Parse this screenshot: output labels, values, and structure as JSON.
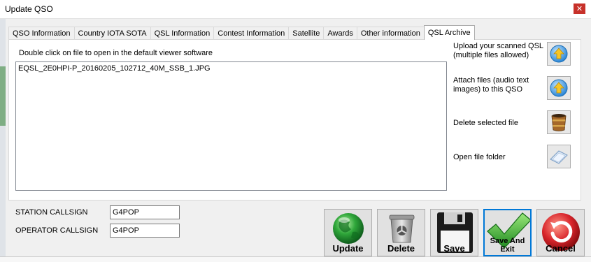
{
  "window": {
    "title": "Update QSO",
    "close_glyph": "✕"
  },
  "tabs": [
    {
      "label": "QSO Information",
      "active": false
    },
    {
      "label": "Country IOTA SOTA",
      "active": false
    },
    {
      "label": "QSL Information",
      "active": false
    },
    {
      "label": "Contest Information",
      "active": false
    },
    {
      "label": "Satellite",
      "active": false
    },
    {
      "label": "Awards",
      "active": false
    },
    {
      "label": "Other information",
      "active": false
    },
    {
      "label": "QSL Archive",
      "active": true
    }
  ],
  "archive": {
    "hint": "Double click on file to open in the default viewer software",
    "files": [
      "EQSL_2E0HPI-P_20160205_102712_40M_SSB_1.JPG"
    ],
    "actions": [
      {
        "label": "Upload your scanned QSL (multiple files allowed)",
        "icon": "upload-arrow-icon"
      },
      {
        "label": "Attach files (audio text images) to this QSO",
        "icon": "upload-arrow-icon"
      },
      {
        "label": "Delete selected file",
        "icon": "bucket-icon"
      },
      {
        "label": "Open file folder",
        "icon": "folder-icon"
      }
    ]
  },
  "fields": {
    "station_callsign_label": "STATION CALLSIGN",
    "station_callsign_value": "G4POP",
    "operator_callsign_label": "OPERATOR CALLSIGN",
    "operator_callsign_value": "G4POP"
  },
  "buttons": {
    "update": "Update",
    "delete": "Delete",
    "save": "Save",
    "save_exit": "Save And Exit",
    "cancel": "Cancel"
  },
  "colors": {
    "accent": "#0078d7",
    "close": "#c7312a",
    "globe": "#2fa73a",
    "check": "#3db33a",
    "cancel": "#d8252b"
  }
}
